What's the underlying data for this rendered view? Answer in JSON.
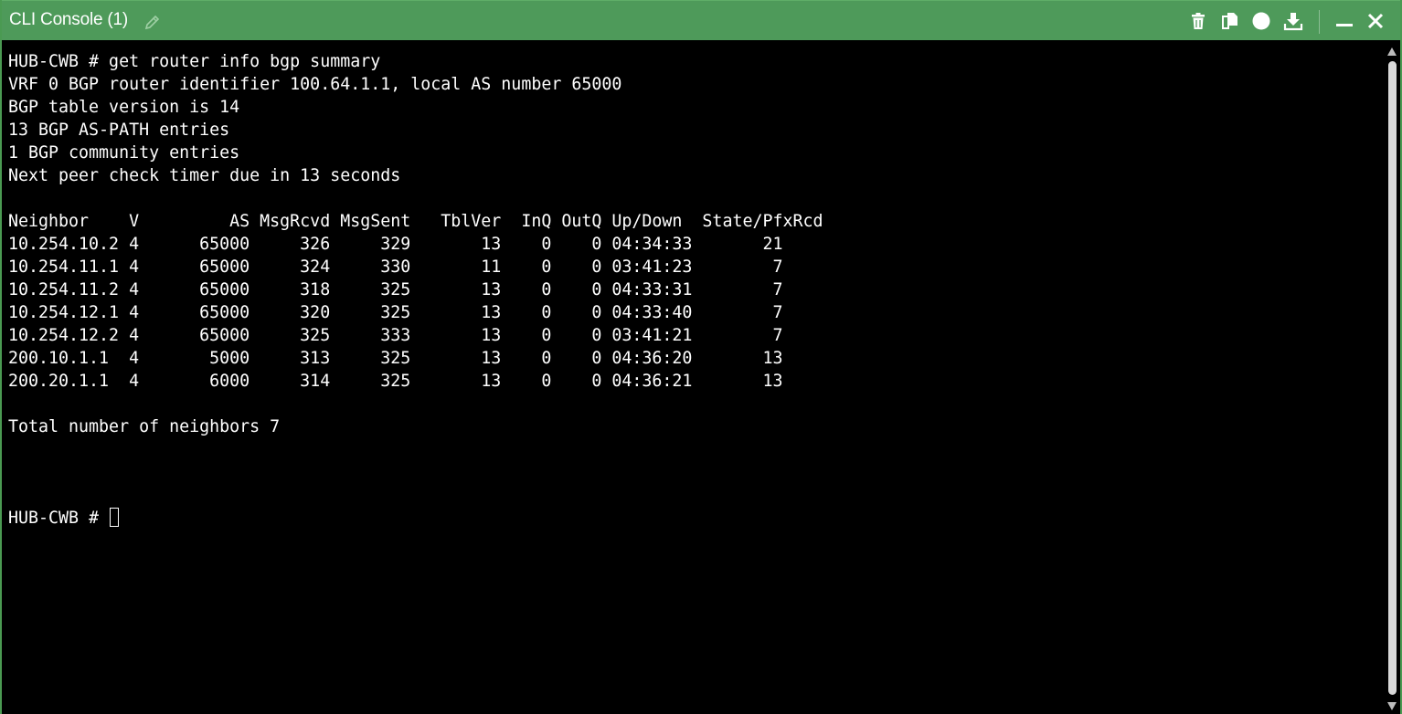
{
  "window": {
    "title": "CLI Console (1)",
    "accent_color": "#4e9a5a",
    "icons": {
      "edit": "pencil-icon",
      "delete": "trash-icon",
      "copy": "copy-icon",
      "record": "record-icon",
      "download": "download-icon",
      "minimize": "minimize-icon",
      "close": "close-icon"
    }
  },
  "terminal": {
    "lines": [
      "HUB-CWB # get router info bgp summary",
      "VRF 0 BGP router identifier 100.64.1.1, local AS number 65000",
      "BGP table version is 14",
      "13 BGP AS-PATH entries",
      "1 BGP community entries",
      "Next peer check timer due in 13 seconds",
      "",
      "Neighbor    V         AS MsgRcvd MsgSent   TblVer  InQ OutQ Up/Down  State/PfxRcd",
      "10.254.10.2 4      65000     326     329       13    0    0 04:34:33       21",
      "10.254.11.1 4      65000     324     330       11    0    0 03:41:23        7",
      "10.254.11.2 4      65000     318     325       13    0    0 04:33:31        7",
      "10.254.12.1 4      65000     320     325       13    0    0 04:33:40        7",
      "10.254.12.2 4      65000     325     333       13    0    0 03:41:21        7",
      "200.10.1.1  4       5000     313     325       13    0    0 04:36:20       13",
      "200.20.1.1  4       6000     314     325       13    0    0 04:36:21       13",
      "",
      "Total number of neighbors 7",
      "",
      "",
      "",
      "HUB-CWB # "
    ]
  }
}
